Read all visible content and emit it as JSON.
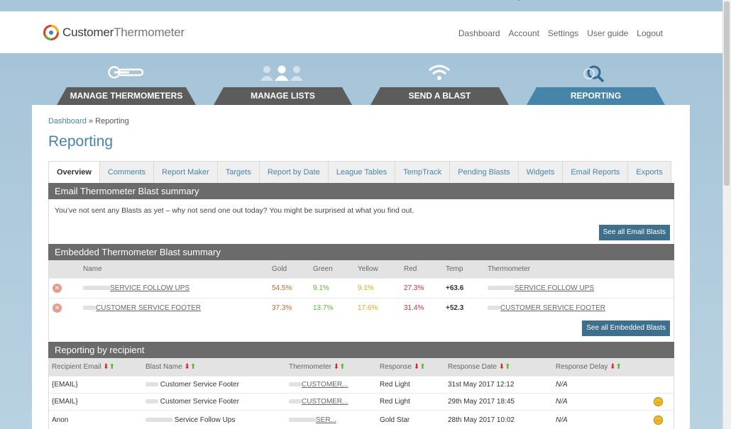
{
  "header": {
    "logo_word1": "Customer",
    "logo_word2": "Thermometer",
    "nav": [
      "Dashboard",
      "Account",
      "Settings",
      "User guide",
      "Logout"
    ]
  },
  "main_tabs": [
    {
      "label": "MANAGE THERMOMETERS",
      "icon": "thermometer-icon"
    },
    {
      "label": "MANAGE LISTS",
      "icon": "people-icon"
    },
    {
      "label": "SEND A BLAST",
      "icon": "wifi-icon"
    },
    {
      "label": "REPORTING",
      "icon": "magnifier-icon",
      "active": true
    }
  ],
  "breadcrumb": {
    "link": "Dashboard",
    "separator": "»",
    "current": "Reporting"
  },
  "page_title": "Reporting",
  "report_tabs": [
    "Overview",
    "Comments",
    "Report Maker",
    "Targets",
    "Report by Date",
    "League Tables",
    "TempTrack",
    "Pending Blasts",
    "Widgets",
    "Email Reports",
    "Exports"
  ],
  "email_summary": {
    "heading": "Email Thermometer Blast summary",
    "message": "You’ve not sent any Blasts as yet – why not send one out today? You might be surprised at what you find out.",
    "button": "See all Email Blasts"
  },
  "embedded_summary": {
    "heading": "Embedded Thermometer Blast summary",
    "columns": [
      "Name",
      "Gold",
      "Green",
      "Yellow",
      "Red",
      "Temp",
      "Thermometer"
    ],
    "rows": [
      {
        "name": "SERVICE FOLLOW UPS",
        "gold": "54.5%",
        "green": "9.1%",
        "yellow": "9.1%",
        "red": "27.3%",
        "temp": "+63.6",
        "thermometer": "SERVICE FOLLOW UPS"
      },
      {
        "name": "CUSTOMER SERVICE FOOTER",
        "gold": "37.3%",
        "green": "13.7%",
        "yellow": "17.6%",
        "red": "31.4%",
        "temp": "+52.3",
        "thermometer": "CUSTOMER SERVICE FOOTER"
      }
    ],
    "button": "See all Embedded Blasts"
  },
  "recipient_report": {
    "heading": "Reporting by recipient",
    "columns": [
      "Recipient Email",
      "Blast Name",
      "Thermometer",
      "Response",
      "Response Date",
      "Response Delay"
    ],
    "rows": [
      {
        "email": "{EMAIL}",
        "blast": "Customer Service Footer",
        "thermometer": "CUSTOMER...",
        "response": "Red Light",
        "date": "31st May 2017 12:12",
        "delay": "N/A",
        "comment": false
      },
      {
        "email": "{EMAIL}",
        "blast": "Customer Service Footer",
        "thermometer": "CUSTOMER...",
        "response": "Red Light",
        "date": "29th May 2017 18:45",
        "delay": "N/A",
        "comment": true
      },
      {
        "email": "Anon",
        "blast": "Service Follow Ups",
        "thermometer": "SER...",
        "response": "Gold Star",
        "date": "28th May 2017 10:02",
        "delay": "N/A",
        "comment": true
      }
    ]
  }
}
